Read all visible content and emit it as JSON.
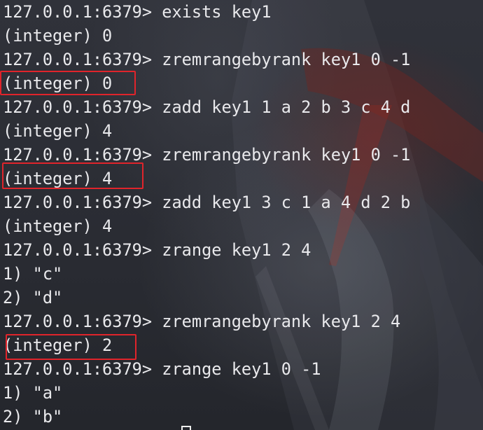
{
  "terminal": {
    "lines": [
      "127.0.0.1:6379> exists key1",
      "(integer) 0",
      "127.0.0.1:6379> zremrangebyrank key1 0 -1",
      "(integer) 0",
      "127.0.0.1:6379> zadd key1 1 a 2 b 3 c 4 d",
      "(integer) 4",
      "127.0.0.1:6379> zremrangebyrank key1 0 -1",
      "(integer) 4",
      "127.0.0.1:6379> zadd key1 3 c 1 a 4 d 2 b",
      "(integer) 4",
      "127.0.0.1:6379> zrange key1 2 4",
      "1) \"c\"",
      "2) \"d\"",
      "127.0.0.1:6379> zremrangebyrank key1 2 4",
      "(integer) 2",
      "127.0.0.1:6379> zrange key1 0 -1",
      "1) \"a\"",
      "2) \"b\""
    ]
  },
  "colors": {
    "background": "#2b2d34",
    "text": "#e9e9ec",
    "highlight_border": "#e0242b"
  },
  "icons": {
    "cursor": "block-cursor-icon"
  }
}
